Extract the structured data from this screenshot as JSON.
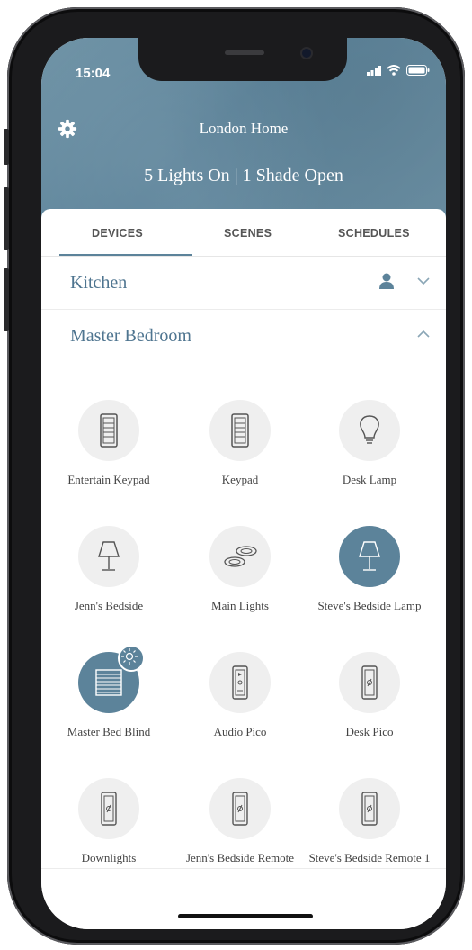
{
  "status_bar": {
    "time": "15:04"
  },
  "header": {
    "home_name": "London Home",
    "summary": "5 Lights On | 1 Shade Open"
  },
  "tabs": [
    {
      "label": "DEVICES",
      "active": true
    },
    {
      "label": "SCENES",
      "active": false
    },
    {
      "label": "SCHEDULES",
      "active": false
    }
  ],
  "rooms": [
    {
      "name": "Kitchen",
      "expanded": false
    },
    {
      "name": "Master Bedroom",
      "expanded": true
    }
  ],
  "devices": [
    {
      "label": "Entertain Keypad",
      "icon": "keypad-icon",
      "on": false
    },
    {
      "label": "Keypad",
      "icon": "keypad-icon",
      "on": false
    },
    {
      "label": "Desk Lamp",
      "icon": "bulb-icon",
      "on": false
    },
    {
      "label": "Jenn's Bedside",
      "icon": "table-lamp-icon",
      "on": false
    },
    {
      "label": "Main Lights",
      "icon": "downlights-icon",
      "on": false
    },
    {
      "label": "Steve's Bedside Lamp",
      "icon": "table-lamp-icon",
      "on": true
    },
    {
      "label": "Master Bed Blind",
      "icon": "blind-icon",
      "on": true
    },
    {
      "label": "Audio Pico",
      "icon": "audio-pico-icon",
      "on": false
    },
    {
      "label": "Desk Pico",
      "icon": "pico-remote-icon",
      "on": false
    },
    {
      "label": "Downlights",
      "icon": "pico-remote-icon",
      "on": false
    },
    {
      "label": "Jenn's Bedside Remote",
      "icon": "pico-remote-icon",
      "on": false
    },
    {
      "label": "Steve's Bedside Remote 1",
      "icon": "pico-remote-icon",
      "on": false
    }
  ],
  "colors": {
    "accent": "#5c839a",
    "room_title": "#4f7590",
    "icon_bg": "#efefef"
  }
}
